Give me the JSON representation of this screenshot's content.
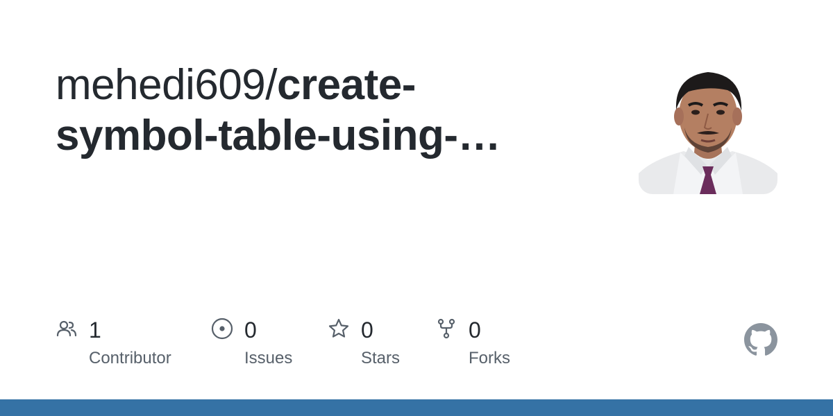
{
  "repo": {
    "owner": "mehedi609/",
    "name_line1": "create-",
    "name_line2": "symbol-table-using-…"
  },
  "stats": [
    {
      "icon": "people-icon",
      "value": "1",
      "label": "Contributor"
    },
    {
      "icon": "issue-icon",
      "value": "0",
      "label": "Issues"
    },
    {
      "icon": "star-icon",
      "value": "0",
      "label": "Stars"
    },
    {
      "icon": "fork-icon",
      "value": "0",
      "label": "Forks"
    }
  ],
  "avatar": {
    "description": "owner-avatar"
  },
  "logo": {
    "icon": "github-icon"
  },
  "colors": {
    "title": "#24292f",
    "label": "#57606a",
    "icon": "#57606a",
    "bar": "#3572a5",
    "logo": "#8b949e"
  }
}
